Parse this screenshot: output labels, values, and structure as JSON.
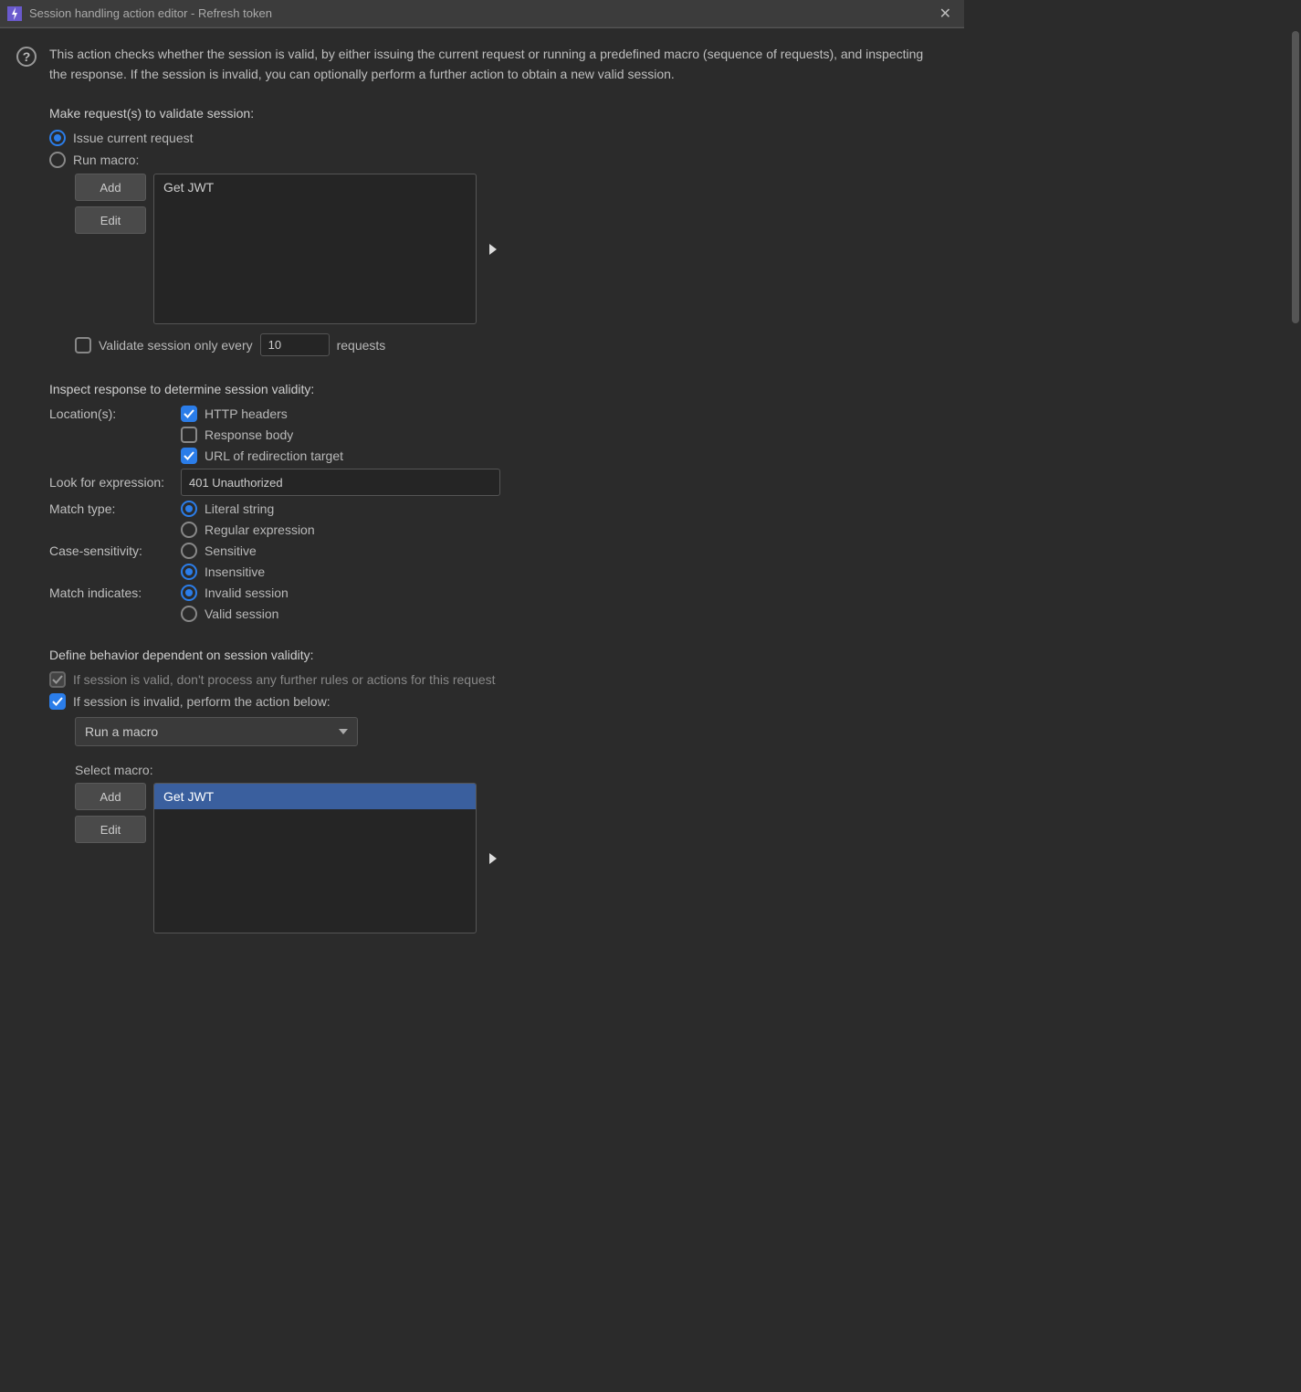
{
  "titlebar": {
    "title": "Session handling action editor - Refresh token"
  },
  "description": "This action checks whether the session is valid, by either issuing the current request or running a predefined macro (sequence of requests), and inspecting the response. If the session is invalid, you can optionally perform a further action to obtain a new valid session.",
  "validate": {
    "heading": "Make request(s) to validate session:",
    "issue_label": "Issue current request",
    "run_macro_label": "Run macro:",
    "add_btn": "Add",
    "edit_btn": "Edit",
    "macro_item": "Get JWT",
    "only_every_label_pre": "Validate session only every",
    "only_every_value": "10",
    "only_every_label_post": "requests"
  },
  "inspect": {
    "heading": "Inspect response to determine session validity:",
    "locations_label": "Location(s):",
    "http_headers": "HTTP headers",
    "response_body": "Response body",
    "url_redirect": "URL of redirection target",
    "expr_label": "Look for expression:",
    "expr_value": "401 Unauthorized",
    "match_type_label": "Match type:",
    "literal": "Literal string",
    "regex": "Regular expression",
    "case_label": "Case-sensitivity:",
    "sensitive": "Sensitive",
    "insensitive": "Insensitive",
    "indicates_label": "Match indicates:",
    "invalid": "Invalid session",
    "valid": "Valid session"
  },
  "behavior": {
    "heading": "Define behavior dependent on session validity:",
    "valid_skip": "If session is valid, don't process any further rules or actions for this request",
    "invalid_action": "If session is invalid, perform the action below:",
    "action_selected": "Run a macro",
    "select_macro": "Select macro:",
    "add_btn": "Add",
    "edit_btn": "Edit",
    "macro_item": "Get JWT"
  }
}
